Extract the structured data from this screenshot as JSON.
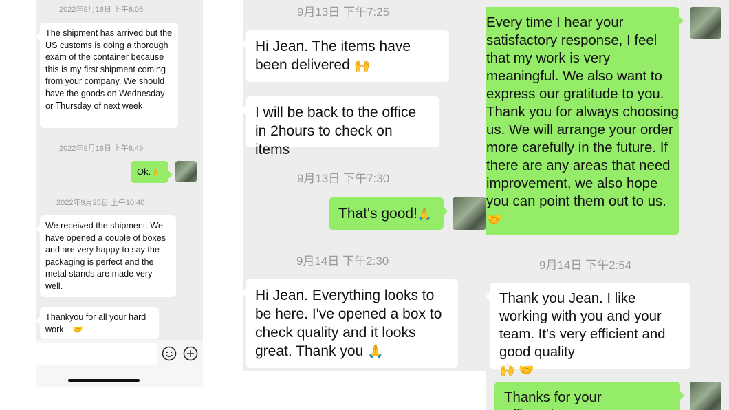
{
  "panel_left": {
    "timestamps": [
      "2022年9月16日 上午6:05",
      "2022年9月16日 上午8:49",
      "2022年9月25日 上午10:40"
    ],
    "messages": [
      "The shipment has arrived but the US customs is doing a thorough exam of the container  because this is my first shipment coming from your company. We should have the goods on Wednesday or Thursday of next week",
      "Ok.",
      "We received the shipment. We have opened a couple of boxes  and are very happy to say the packaging is perfect and the metal stands are made very well.",
      "Thankyou for all your hard work."
    ],
    "emoji": {
      "ok_hand": "👌",
      "handshake": "🤝"
    }
  },
  "panel_middle": {
    "timestamps": [
      "9月13日 下午7:25",
      "9月13日 下午7:30",
      "9月14日 下午2:30"
    ],
    "messages": [
      "Hi Jean. The items have been delivered",
      "I will be back to the office in 2hours to check on items",
      "That's good!",
      "Hi Jean. Everything looks to be here. I've opened a box to check quality and it looks great. Thank you"
    ],
    "emoji": {
      "raised_hands": "🙌",
      "folded_hands": "🙏"
    }
  },
  "panel_right": {
    "timestamps": [
      "9月14日 下午2:54"
    ],
    "messages": [
      "Every time I hear your satisfactory response, I feel that my work is very meaningful. We also want to express our gratitude to you. Thank you for always choosing us. We will arrange your order more carefully in the future. If there are any areas that need improvement, we also hope you can point them out to us.",
      "Thank you Jean. I like working with you and your team. It's very efficient and good quality",
      "Thanks for your affirmation,"
    ],
    "emoji": {
      "handshake": "🤝",
      "raised_hands": "🙌"
    }
  },
  "icons": {
    "emoji_button": "smiley-icon",
    "add_button": "plus-icon"
  },
  "colors": {
    "background": "#ededed",
    "outgoing_bubble": "#95ec69",
    "incoming_bubble": "#ffffff",
    "timestamp": "#9a9a9a"
  }
}
